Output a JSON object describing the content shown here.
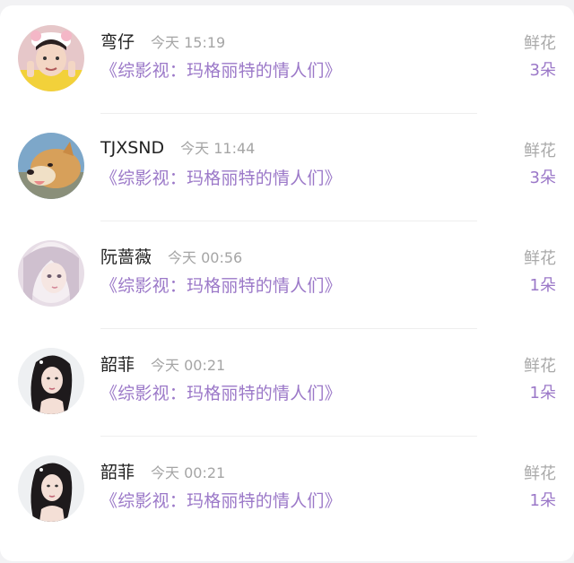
{
  "records": [
    {
      "name": "弯仔",
      "time": "今天 15:19",
      "work": "《综影视：玛格丽特的情人们》",
      "gift": "鲜花",
      "count": "3朵",
      "avatar_icon": "girl-photo-avatar"
    },
    {
      "name": "TJXSND",
      "time": "今天 11:44",
      "work": "《综影视：玛格丽特的情人们》",
      "gift": "鲜花",
      "count": "3朵",
      "avatar_icon": "dog-photo-avatar"
    },
    {
      "name": "阮蔷薇",
      "time": "今天 00:56",
      "work": "《综影视：玛格丽特的情人们》",
      "gift": "鲜花",
      "count": "1朵",
      "avatar_icon": "illustrated-girl-avatar"
    },
    {
      "name": "韶菲",
      "time": "今天 00:21",
      "work": "《综影视：玛格丽特的情人们》",
      "gift": "鲜花",
      "count": "1朵",
      "avatar_icon": "woman-photo-avatar"
    },
    {
      "name": "韶菲",
      "time": "今天 00:21",
      "work": "《综影视：玛格丽特的情人们》",
      "gift": "鲜花",
      "count": "1朵",
      "avatar_icon": "woman-photo-avatar"
    }
  ],
  "colors": {
    "accent_purple": "#9b78c8",
    "muted_gray": "#a9a9a9",
    "name_text": "#222222"
  }
}
